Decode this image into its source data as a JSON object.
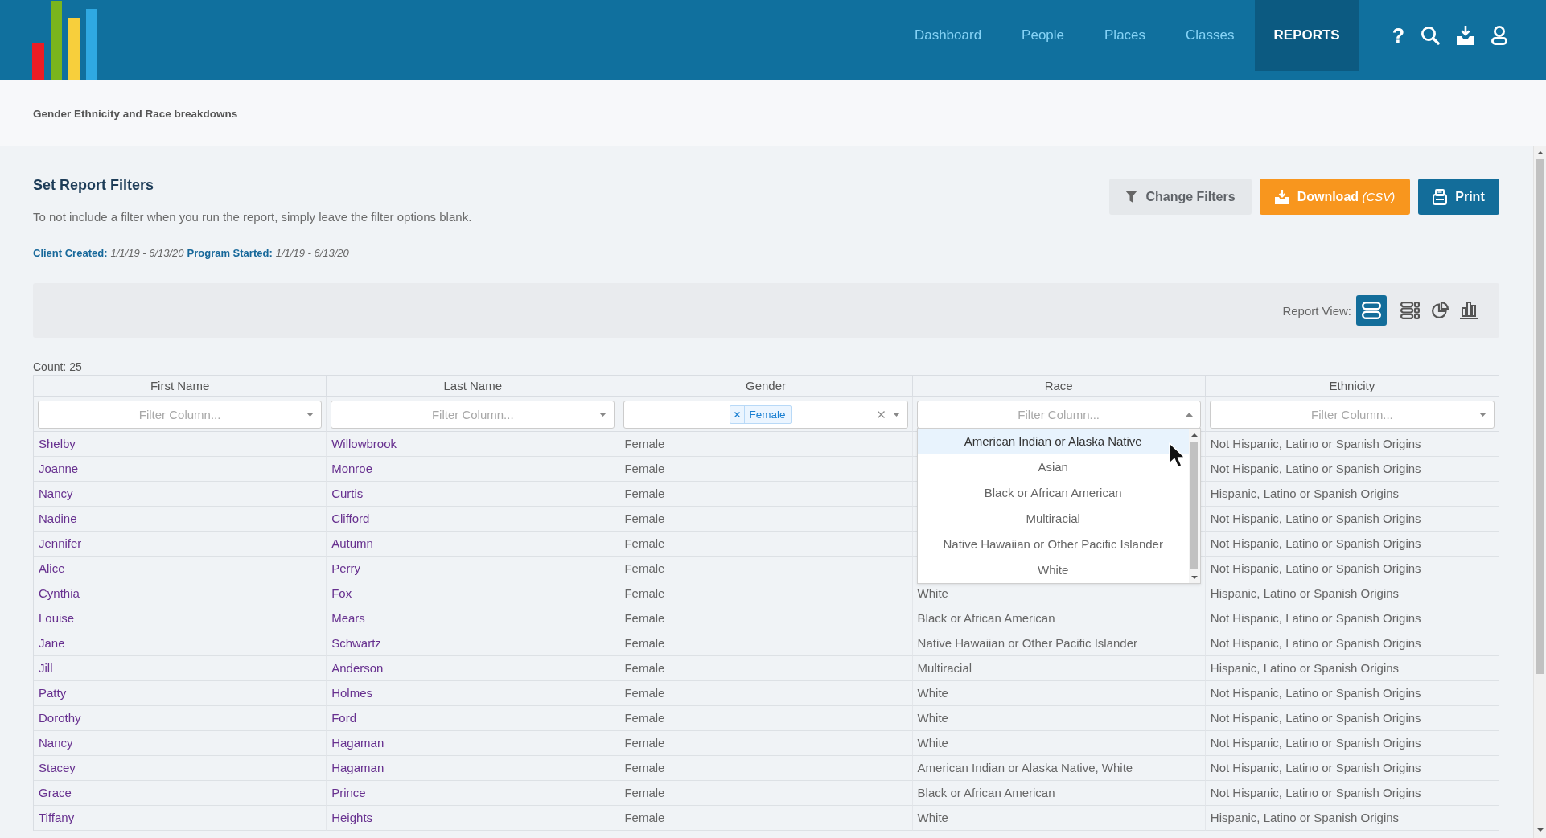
{
  "header": {
    "nav": [
      {
        "label": "Dashboard",
        "selected": false
      },
      {
        "label": "People",
        "selected": false
      },
      {
        "label": "Places",
        "selected": false
      },
      {
        "label": "Classes",
        "selected": false
      },
      {
        "label": "REPORTS",
        "selected": true
      }
    ],
    "help": "?"
  },
  "breadcrumb": "Gender Ethnicity and Race breakdowns",
  "filters": {
    "title": "Set Report Filters",
    "description": "To not include a filter when you run the report, simply leave the filter options blank.",
    "applied": [
      {
        "label": "Client Created:",
        "value": "1/1/19 - 6/13/20"
      },
      {
        "label": "Program Started:",
        "value": "1/1/19 - 6/13/20"
      }
    ]
  },
  "actions": [
    {
      "kind": "filter",
      "label": "Change Filters"
    },
    {
      "kind": "download",
      "label": "Download *(CSV)*"
    },
    {
      "kind": "print",
      "label": "Print"
    }
  ],
  "report_view": {
    "label": "Report View:",
    "views": [
      {
        "kind": "rows",
        "selected": true
      },
      {
        "kind": "list",
        "selected": false
      },
      {
        "kind": "pie",
        "selected": false
      },
      {
        "kind": "bar",
        "selected": false
      }
    ]
  },
  "table": {
    "count": "Count: 25",
    "columns": [
      {
        "label": "First Name",
        "filter": {
          "placeholder": "Filter Column...",
          "expanded": false
        }
      },
      {
        "label": "Last Name",
        "filter": {
          "placeholder": "Filter Column...",
          "expanded": false
        }
      },
      {
        "label": "Gender",
        "filter": {
          "tags": [
            "Female"
          ],
          "expanded": false
        }
      },
      {
        "label": "Race",
        "filter": {
          "placeholder": "Filter Column...",
          "expanded": true,
          "options": [
            {
              "label": "American Indian or Alaska Native",
              "highlighted": true
            },
            {
              "label": "Asian",
              "highlighted": false
            },
            {
              "label": "Black or African American",
              "highlighted": false
            },
            {
              "label": "Multiracial",
              "highlighted": false
            },
            {
              "label": "Native Hawaiian or Other Pacific Islander",
              "highlighted": false
            },
            {
              "label": "White",
              "highlighted": false
            }
          ]
        }
      },
      {
        "label": "Ethnicity",
        "filter": {
          "placeholder": "Filter Column...",
          "expanded": false
        }
      }
    ],
    "rows": [
      {
        "first_name": "Shelby",
        "last_name": "Willowbrook",
        "gender": "Female",
        "ethnicity": "Not Hispanic, Latino or Spanish Origins"
      },
      {
        "first_name": "Joanne",
        "last_name": "Monroe",
        "gender": "Female",
        "ethnicity": "Not Hispanic, Latino or Spanish Origins"
      },
      {
        "first_name": "Nancy",
        "last_name": "Curtis",
        "gender": "Female",
        "ethnicity": "Hispanic, Latino or Spanish Origins"
      },
      {
        "first_name": "Nadine",
        "last_name": "Clifford",
        "gender": "Female",
        "ethnicity": "Not Hispanic, Latino or Spanish Origins"
      },
      {
        "first_name": "Jennifer",
        "last_name": "Autumn",
        "gender": "Female",
        "ethnicity": "Not Hispanic, Latino or Spanish Origins"
      },
      {
        "first_name": "Alice",
        "last_name": "Perry",
        "gender": "Female",
        "ethnicity": "Not Hispanic, Latino or Spanish Origins"
      },
      {
        "first_name": "Cynthia",
        "last_name": "Fox",
        "gender": "Female",
        "race": "White",
        "ethnicity": "Hispanic, Latino or Spanish Origins"
      },
      {
        "first_name": "Louise",
        "last_name": "Mears",
        "gender": "Female",
        "race": "Black or African American",
        "ethnicity": "Not Hispanic, Latino or Spanish Origins"
      },
      {
        "first_name": "Jane",
        "last_name": "Schwartz",
        "gender": "Female",
        "race": "Native Hawaiian or Other Pacific Islander",
        "ethnicity": "Not Hispanic, Latino or Spanish Origins"
      },
      {
        "first_name": "Jill",
        "last_name": "Anderson",
        "gender": "Female",
        "race": "Multiracial",
        "ethnicity": "Hispanic, Latino or Spanish Origins"
      },
      {
        "first_name": "Patty",
        "last_name": "Holmes",
        "gender": "Female",
        "race": "White",
        "ethnicity": "Not Hispanic, Latino or Spanish Origins"
      },
      {
        "first_name": "Dorothy",
        "last_name": "Ford",
        "gender": "Female",
        "race": "White",
        "ethnicity": "Not Hispanic, Latino or Spanish Origins"
      },
      {
        "first_name": "Nancy",
        "last_name": "Hagaman",
        "gender": "Female",
        "race": "White",
        "ethnicity": "Not Hispanic, Latino or Spanish Origins"
      },
      {
        "first_name": "Stacey",
        "last_name": "Hagaman",
        "gender": "Female",
        "race": "American Indian or Alaska Native, White",
        "ethnicity": "Not Hispanic, Latino or Spanish Origins"
      },
      {
        "first_name": "Grace",
        "last_name": "Prince",
        "gender": "Female",
        "race": "Black or African American",
        "ethnicity": "Not Hispanic, Latino or Spanish Origins"
      },
      {
        "first_name": "Tiffany",
        "last_name": "Heights",
        "gender": "Female",
        "race": "White",
        "ethnicity": "Hispanic, Latino or Spanish Origins"
      }
    ]
  }
}
